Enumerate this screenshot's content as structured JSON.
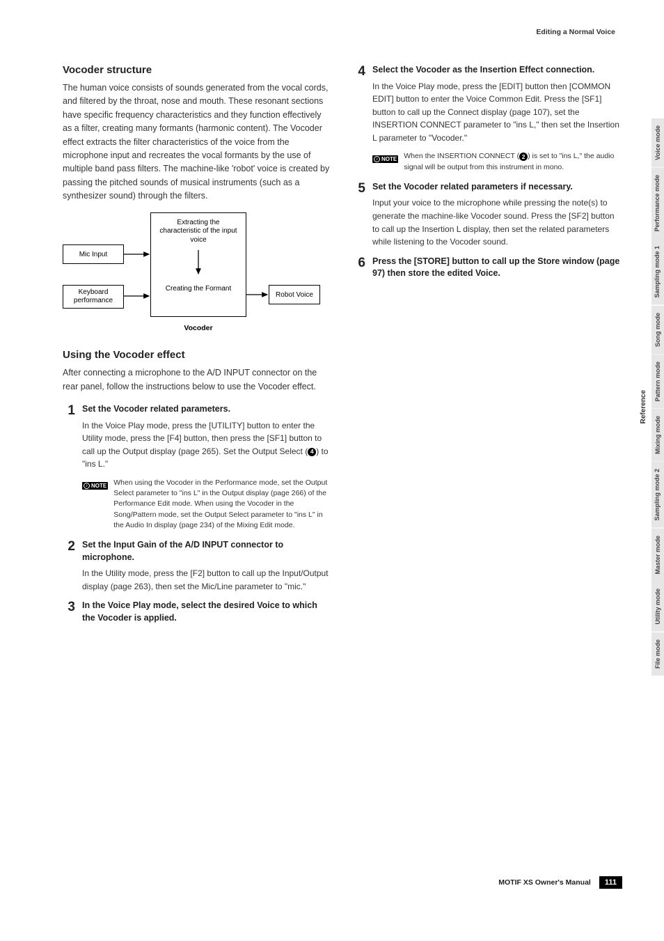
{
  "header": {
    "section": "Editing a Normal Voice"
  },
  "left": {
    "h1a": "Vocoder structure",
    "p1": "The human voice consists of sounds generated from the vocal cords, and filtered by the throat, nose and mouth. These resonant sections have specific frequency characteristics and they function effectively as a filter, creating many formants (harmonic content). The Vocoder effect extracts the filter characteristics of the voice from the microphone input and recreates the vocal formants by the use of multiple band pass filters. The machine-like 'robot' voice is created by passing the pitched sounds of musical instruments (such as a synthesizer sound) through the filters.",
    "diagram": {
      "mic": "Mic Input",
      "keyboard": "Keyboard performance",
      "extract": "Extracting the characteristic of the input voice",
      "formant": "Creating the Formant",
      "robot": "Robot Voice",
      "caption": "Vocoder"
    },
    "h1b": "Using the Vocoder effect",
    "p2": "After connecting a microphone to the A/D INPUT connector on the rear panel, follow the instructions below to use the Vocoder effect.",
    "s1": {
      "title": "Set the Vocoder related parameters.",
      "text": "In the Voice Play mode, press the [UTILITY] button to enter the Utility mode, press the [F4] button, then press the [SF1] button to call up the Output display (page 265). Set the Output Select (",
      "text_after": ") to \"ins L.\""
    },
    "note1": "When using the Vocoder in the Performance mode, set the Output Select parameter to \"ins L\" in the Output display (page 266) of the Performance Edit mode. When using the Vocoder in the Song/Pattern mode, set the Output Select parameter to \"ins L\" in the Audio In display (page 234) of the Mixing Edit mode.",
    "s2": {
      "title": "Set the Input Gain of the A/D INPUT connector to microphone.",
      "text": "In the Utility mode, press the [F2] button to call up the Input/Output display (page 263), then set the Mic/Line parameter to \"mic.\""
    },
    "s3": {
      "title": "In the Voice Play mode, select the desired Voice to which the Vocoder is applied."
    }
  },
  "right": {
    "s4": {
      "title": "Select the Vocoder as the Insertion Effect connection.",
      "text": "In the Voice Play mode, press the [EDIT] button then [COMMON EDIT] button to enter the Voice Common Edit. Press the [SF1] button to call up the Connect display (page 107), set the INSERTION CONNECT parameter to \"ins L,\" then set the Insertion L parameter to \"Vocoder.\""
    },
    "note2a": "When the INSERTION CONNECT (",
    "note2b": ") is set to \"ins L,\" the audio signal will be output from this instrument in mono.",
    "s5": {
      "title": "Set the Vocoder related parameters if necessary.",
      "text": "Input your voice to the microphone while pressing the note(s) to generate the machine-like Vocoder sound. Press the [SF2] button to call up the Insertion L display, then set the related parameters while listening to the Vocoder sound."
    },
    "s6": {
      "title": "Press the [STORE] button to call up the Store window (page 97) then store the edited Voice."
    }
  },
  "tabs": [
    "Voice mode",
    "Performance mode",
    "Sampling mode 1",
    "Song mode",
    "Pattern mode",
    "Mixing mode",
    "Sampling mode 2",
    "Master mode",
    "Utility mode",
    "File mode"
  ],
  "ref": "Reference",
  "footer": {
    "book": "MOTIF XS Owner's Manual",
    "page": "111"
  },
  "nums": {
    "n1": "1",
    "n2": "2",
    "n3": "3",
    "n4": "4",
    "n5": "5",
    "n6": "6",
    "c4": "4",
    "c2": "2"
  },
  "notelabel": "NOTE"
}
